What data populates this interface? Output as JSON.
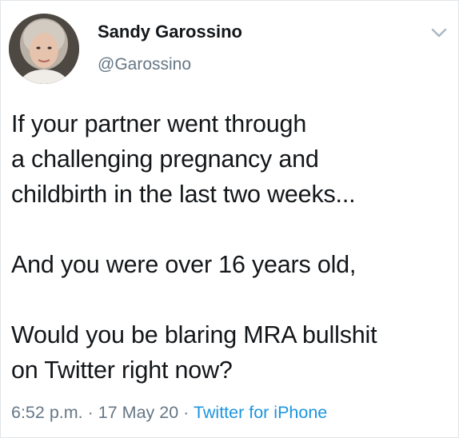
{
  "user": {
    "display_name": "Sandy Garossino",
    "handle": "@Garossino"
  },
  "tweet": {
    "paragraphs": [
      {
        "lines": [
          "If your partner went through",
          "a challenging pregnancy and",
          "childbirth in the last two weeks..."
        ]
      },
      {
        "lines": [
          "And you were over 16 years old,"
        ]
      },
      {
        "lines": [
          "Would you be blaring MRA bullshit",
          "on Twitter right now?"
        ]
      }
    ]
  },
  "meta": {
    "time": "6:52 p.m.",
    "separator": "·",
    "date": "17 May 20",
    "source": "Twitter for iPhone"
  },
  "icons": {
    "avatar": "user-photo",
    "menu": "chevron-down-icon"
  },
  "colors": {
    "text": "#14171a",
    "secondary": "#657786",
    "link": "#1b95e0"
  }
}
